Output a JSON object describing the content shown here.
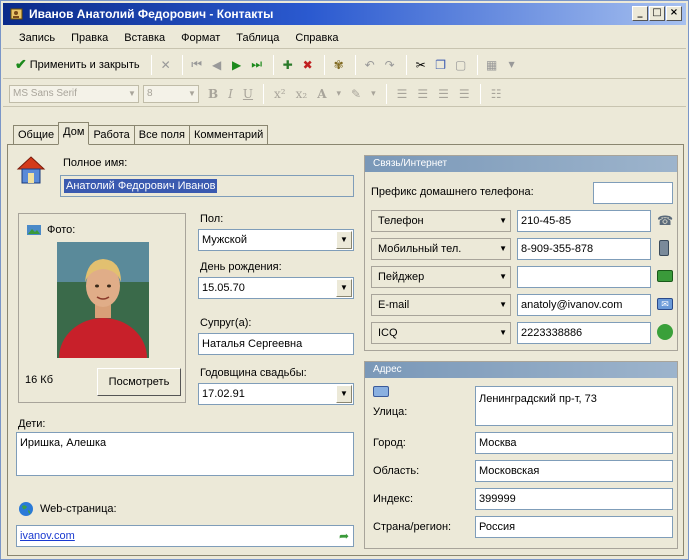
{
  "window": {
    "title": "Иванов Анатолий Федорович - Контакты",
    "controls": [
      "_",
      "□",
      "×"
    ]
  },
  "menu": [
    "Запись",
    "Правка",
    "Вставка",
    "Формат",
    "Таблица",
    "Справка"
  ],
  "toolbar": {
    "apply_label": "Применить и закрыть"
  },
  "format": {
    "font": "MS Sans Serif",
    "size": "8",
    "bold": "B",
    "italic": "I",
    "underline": "U",
    "font_color": "A"
  },
  "tabs": [
    "Общие",
    "Дом",
    "Работа",
    "Все поля",
    "Комментарий"
  ],
  "active_tab": "Дом",
  "fullname": {
    "label": "Полное имя:",
    "value": "Анатолий Федорович Иванов"
  },
  "photo": {
    "label": "Фото:",
    "size": "16 Кб",
    "view_button": "Посмотреть"
  },
  "personal": {
    "gender_label": "Пол:",
    "gender_value": "Мужской",
    "birthday_label": "День рождения:",
    "birthday_value": "15.05.70",
    "spouse_label": "Супруг(а):",
    "spouse_value": "Наталья Сергеевна",
    "anniversary_label": "Годовщина свадьбы:",
    "anniversary_value": "17.02.91"
  },
  "children": {
    "label": "Дети:",
    "value": "Иришка, Алешка"
  },
  "web": {
    "label": "Web-страница:",
    "value": "ivanov.com"
  },
  "contact": {
    "title": "Связь/Интернет",
    "prefix_label": "Префикс домашнего телефона:",
    "prefix_value": "",
    "rows": [
      {
        "type": "Телефон",
        "value": "210-45-85"
      },
      {
        "type": "Мобильный тел.",
        "value": "8-909-355-878"
      },
      {
        "type": "Пейджер",
        "value": ""
      },
      {
        "type": "E-mail",
        "value": "anatoly@ivanov.com"
      },
      {
        "type": "ICQ",
        "value": "2223338886"
      }
    ]
  },
  "address": {
    "title": "Адрес",
    "street_label": "Улица:",
    "street_value": "Ленинградский пр-т, 73",
    "city_label": "Город:",
    "city_value": "Москва",
    "region_label": "Область:",
    "region_value": "Московская",
    "zip_label": "Индекс:",
    "zip_value": "399999",
    "country_label": "Страна/регион:",
    "country_value": "Россия"
  }
}
